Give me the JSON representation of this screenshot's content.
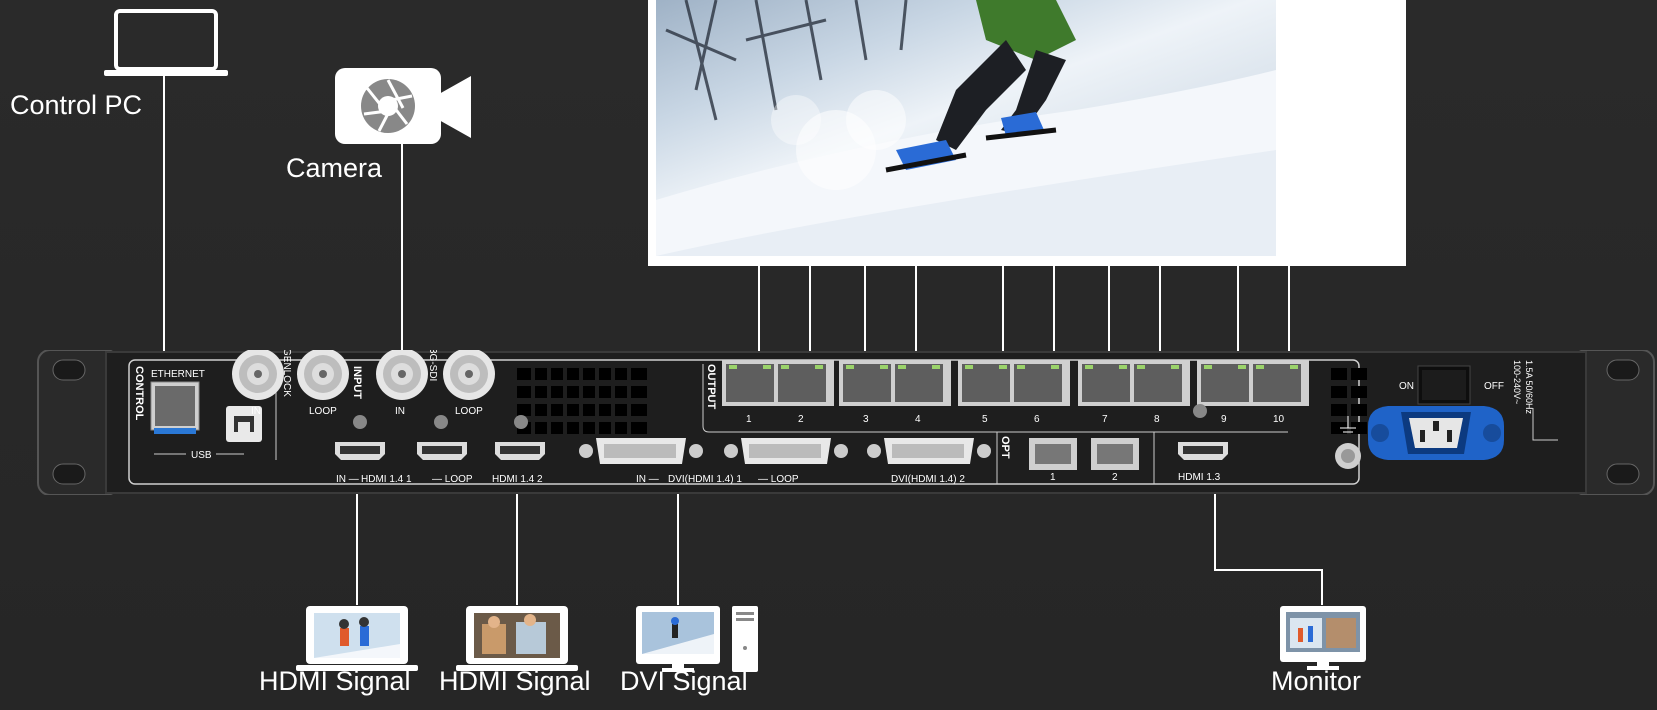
{
  "captions": {
    "control_pc": "Control PC",
    "camera": "Camera",
    "hdmi_signal_1": "HDMI Signal",
    "hdmi_signal_2": "HDMI Signal",
    "dvi_signal": "DVI Signal",
    "monitor": "Monitor"
  },
  "panel": {
    "control": "CONTROL",
    "ethernet": "ETHERNET",
    "usb": "USB",
    "genlock": "GENLOCK",
    "input": "INPUT",
    "sdi": "3G-SDI",
    "in": "IN",
    "loop": "LOOP",
    "output": "OUTPUT",
    "opt": "OPT",
    "hdmi14_1": "HDMI 1.4 1",
    "hdmi14_2": "HDMI 1.4 2",
    "dvi1": "DVI(HDMI 1.4) 1",
    "dvi2": "DVI(HDMI 1.4) 2",
    "hdmi13": "HDMI 1.3",
    "in_dash": "IN —",
    "dash_loop": "— LOOP",
    "port_numbers": [
      "1",
      "2",
      "3",
      "4",
      "5",
      "6",
      "7",
      "8",
      "9",
      "10"
    ],
    "opt_numbers": [
      "1",
      "2"
    ],
    "on": "ON",
    "off": "OFF",
    "power_rating_1": "1.5A 50/60Hz",
    "power_rating_2": "100-240V~"
  },
  "colors": {
    "background": "#282828",
    "chassis": "#1e1e1e",
    "power_socket": "#1f63c8",
    "line": "#ffffff"
  },
  "icons": [
    "laptop-icon",
    "camera-icon",
    "monitor-icon",
    "desktop-computer-icon",
    "ethernet-port-icon",
    "usb-b-port-icon",
    "bnc-connector-icon",
    "hdmi-port-icon",
    "dvi-port-icon",
    "sfp-port-icon",
    "power-socket-icon",
    "power-switch-icon",
    "ground-icon"
  ]
}
